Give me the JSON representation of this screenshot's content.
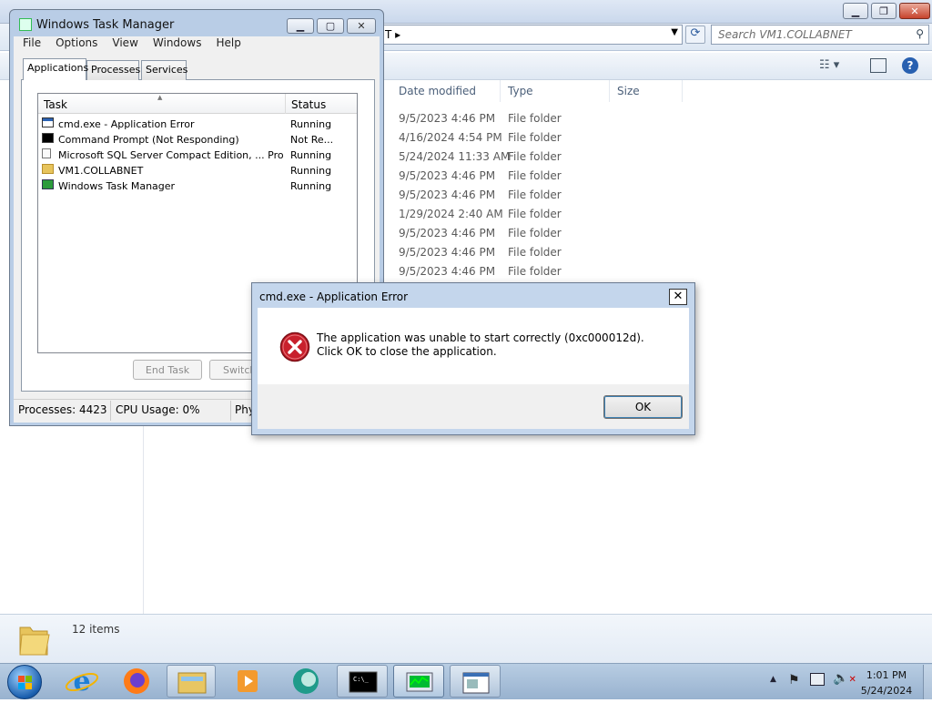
{
  "explorer": {
    "address_arrow": "T ▸",
    "search_placeholder": "Search VM1.COLLABNET",
    "columns": [
      "Date modified",
      "Type",
      "Size"
    ],
    "rows": [
      {
        "date": "9/5/2023 4:46 PM",
        "type": "File folder"
      },
      {
        "date": "4/16/2024 4:54 PM",
        "type": "File folder"
      },
      {
        "date": "5/24/2024 11:33 AM",
        "type": "File folder"
      },
      {
        "date": "9/5/2023 4:46 PM",
        "type": "File folder"
      },
      {
        "date": "9/5/2023 4:46 PM",
        "type": "File folder"
      },
      {
        "date": "1/29/2024 2:40 AM",
        "type": "File folder"
      },
      {
        "date": "9/5/2023 4:46 PM",
        "type": "File folder"
      },
      {
        "date": "9/5/2023 4:46 PM",
        "type": "File folder"
      },
      {
        "date": "9/5/2023 4:46 PM",
        "type": "File folder"
      }
    ],
    "item_count": "12 items"
  },
  "task_manager": {
    "title": "Windows Task Manager",
    "menu": [
      "File",
      "Options",
      "View",
      "Windows",
      "Help"
    ],
    "tabs": [
      "Applications",
      "Processes",
      "Services"
    ],
    "columns": {
      "task": "Task",
      "status": "Status"
    },
    "tasks": [
      {
        "name": "cmd.exe - Application Error",
        "status": "Running",
        "icon": "window-icon"
      },
      {
        "name": "Command Prompt (Not Responding)",
        "status": "Not Re...",
        "icon": "cmd-icon"
      },
      {
        "name": "Microsoft SQL Server Compact Edition, ... Prope...",
        "status": "Running",
        "icon": "document-icon"
      },
      {
        "name": "VM1.COLLABNET",
        "status": "Running",
        "icon": "folder-icon"
      },
      {
        "name": "Windows Task Manager",
        "status": "Running",
        "icon": "task-manager-icon"
      }
    ],
    "buttons": {
      "end_task": "End Task",
      "switch_to": "Switch"
    },
    "status_bar": {
      "processes": "Processes: 4423",
      "cpu": "CPU Usage: 0%",
      "physical": "Phy"
    }
  },
  "error_dialog": {
    "title": "cmd.exe - Application Error",
    "message": "The application was unable to start correctly (0xc000012d). Click OK to close the application.",
    "ok_label": "OK",
    "close_label": "✕",
    "icon": "error-icon"
  },
  "taskbar": {
    "time": "1:01 PM",
    "date": "5/24/2024",
    "pinned": [
      "start-orb",
      "internet-explorer-icon",
      "firefox-icon",
      "explorer-icon",
      "media-player-icon",
      "app-icon",
      "cmd-icon",
      "task-manager-icon",
      "window-icon"
    ]
  }
}
